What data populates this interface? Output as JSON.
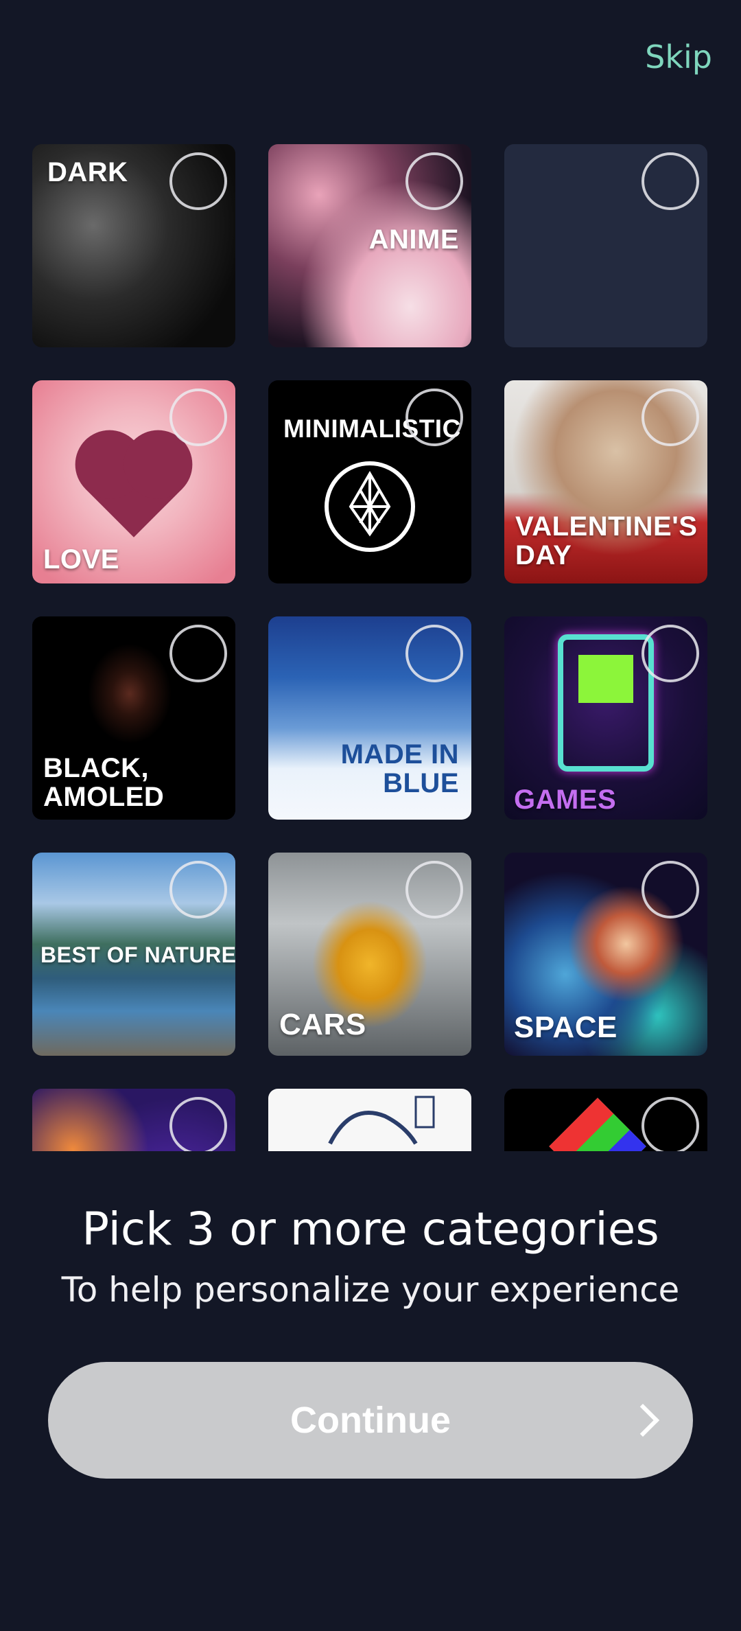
{
  "header": {
    "skip_label": "Skip"
  },
  "categories": [
    {
      "label": "DARK",
      "selected": false
    },
    {
      "label": "ANIME",
      "selected": false
    },
    {
      "label": "",
      "selected": false
    },
    {
      "label": "LOVE",
      "selected": false
    },
    {
      "label": "MINIMALISTIC",
      "selected": false
    },
    {
      "label": "VALENTINE'S DAY",
      "selected": false
    },
    {
      "label": "BLACK, AMOLED",
      "selected": false
    },
    {
      "label": "MADE IN BLUE",
      "selected": false
    },
    {
      "label": "GAMES",
      "selected": false
    },
    {
      "label": "BEST OF NATURE",
      "selected": false
    },
    {
      "label": "CARS",
      "selected": false
    },
    {
      "label": "SPACE",
      "selected": false
    },
    {
      "label": "",
      "selected": false
    },
    {
      "label": "",
      "selected": false
    },
    {
      "label": "",
      "selected": false
    }
  ],
  "prompt": {
    "title": "Pick 3 or more categories",
    "subtitle": "To help personalize your experience"
  },
  "footer": {
    "continue_label": "Continue"
  },
  "colors": {
    "background": "#131726",
    "accent": "#7fd6bd",
    "button_disabled": "#c9cacc"
  }
}
